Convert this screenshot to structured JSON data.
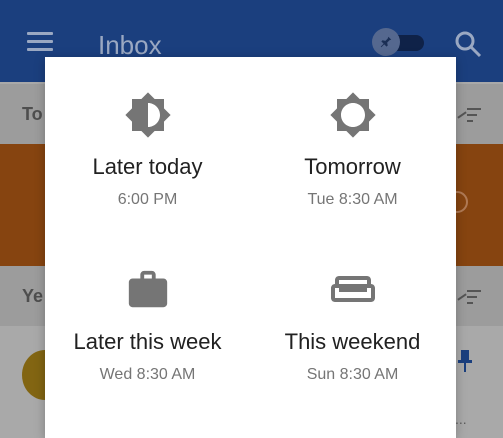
{
  "app": {
    "title": "Inbox",
    "sections": [
      "To",
      "Ye"
    ],
    "list_item_snippet": "..."
  },
  "snooze_dialog": {
    "options": [
      {
        "label": "Later today",
        "time": "6:00 PM",
        "icon": "brightness-half-icon"
      },
      {
        "label": "Tomorrow",
        "time": "Tue 8:30 AM",
        "icon": "brightness-sun-icon"
      },
      {
        "label": "Later this week",
        "time": "Wed 8:30 AM",
        "icon": "briefcase-icon"
      },
      {
        "label": "This weekend",
        "time": "Sun 8:30 AM",
        "icon": "sofa-icon"
      }
    ]
  },
  "colors": {
    "appbar": "#1b3f7e",
    "accent_card": "#864410",
    "icon_gray": "#757575"
  }
}
